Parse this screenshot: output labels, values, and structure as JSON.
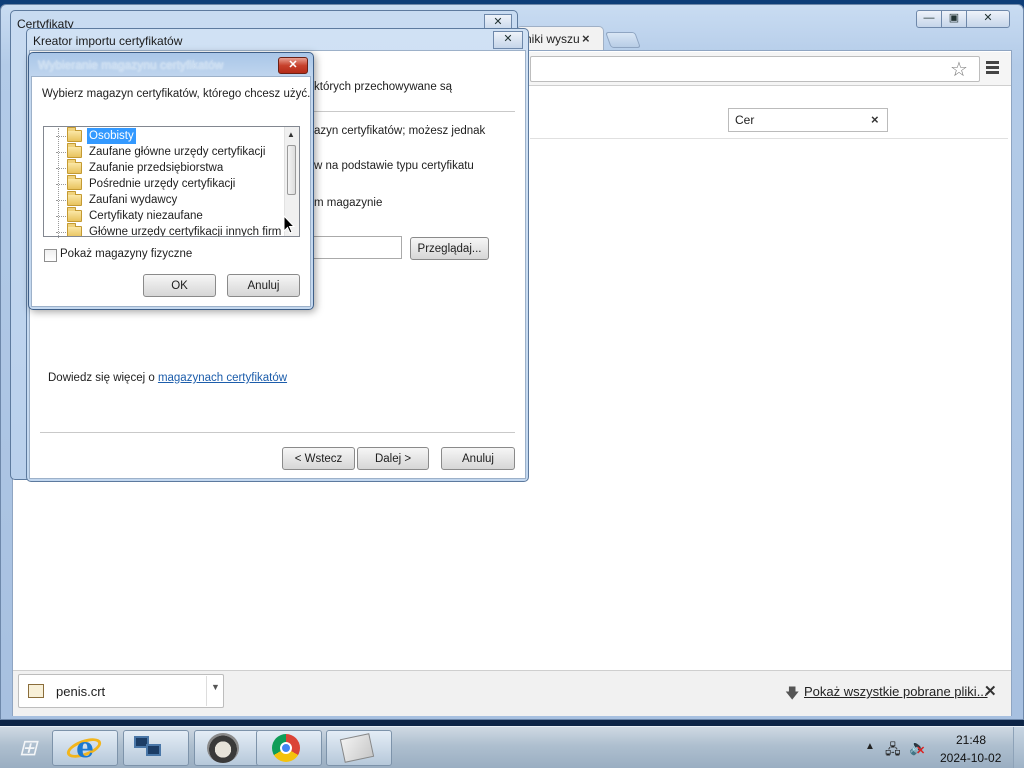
{
  "browser": {
    "tab_title": "niki wyszu",
    "tab_close": "×",
    "find_query": "Cer",
    "find_close": "×",
    "window_controls": {
      "minimize": "—",
      "maximize": "▣",
      "close": "✕"
    },
    "star_icon": "star-icon",
    "menu_icon": "hamburger-menu-icon"
  },
  "downloads": {
    "filename": "penis.crt",
    "dropdown": "▼",
    "show_all_label": "Pokaż wszystkie pobrane pliki...",
    "close": "✕"
  },
  "cert_window": {
    "title": "Certyfikaty",
    "close": "✕"
  },
  "wizard": {
    "title": "Kreator importu certyfikatów",
    "close": "✕",
    "text_stored": "których przechowywane są",
    "text_magazyn": "azyn certyfikatów; możesz jednak",
    "text_typ": "w na podstawie typu certyfikatu",
    "text_magazynie": "m magazynie",
    "browse_button": "Przeglądaj...",
    "learn_more_prefix": "Dowiedz się więcej o ",
    "learn_more_link": "magazynach certyfikatów",
    "back_button": "< Wstecz",
    "next_button": "Dalej >",
    "cancel_button": "Anuluj"
  },
  "store_dialog": {
    "title": "Wybieranie magazynu certyfikatów",
    "close": "✕",
    "prompt": "Wybierz magazyn certyfikatów, którego chcesz użyć.",
    "stores": [
      {
        "label": "Osobisty",
        "selected": true
      },
      {
        "label": "Zaufane główne urzędy certyfikacji",
        "selected": false
      },
      {
        "label": "Zaufanie przedsiębiorstwa",
        "selected": false
      },
      {
        "label": "Pośrednie urzędy certyfikacji",
        "selected": false
      },
      {
        "label": "Zaufani wydawcy",
        "selected": false
      },
      {
        "label": "Certyfikaty niezaufane",
        "selected": false
      },
      {
        "label": "Główne urzędy certyfikacji innych firm",
        "selected": false
      }
    ],
    "show_physical_label": "Pokaż magazyny fizyczne",
    "show_physical_checked": false,
    "ok_button": "OK",
    "cancel_button": "Anuluj"
  },
  "taskbar": {
    "start_icon": "windows-start-icon",
    "items": [
      "internet-explorer",
      "network-monitor",
      "raccoon-app",
      "google-chrome",
      "certificate-manager"
    ],
    "tray_arrow": "▲",
    "clock_time": "21:48",
    "clock_date": "2024-10-02"
  }
}
